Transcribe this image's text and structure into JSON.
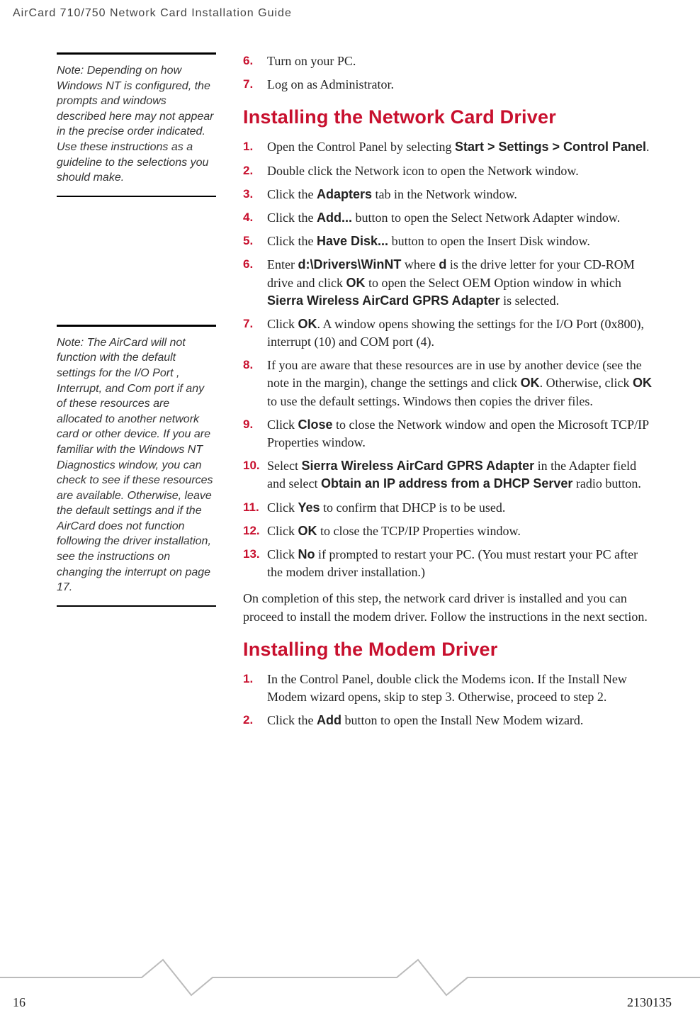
{
  "header": "AirCard 710/750 Network Card Installation Guide",
  "notes": [
    "Note:  Depending on how Windows NT is configured, the prompts and windows described here may not appear in the precise order indicated. Use these instructions as a guideline to the selections you should make.",
    "Note:  The AirCard will not function with the default settings for the I/O Port , Interrupt, and Com port if any of these resources are allocated to another network card or other device. If you are familiar with the Windows NT Diagnostics window, you can check to see if these resources are available. Otherwise, leave the default settings and if the AirCard does not function following the driver installation, see the instructions on changing the interrupt on page 17."
  ],
  "prelim_steps": [
    {
      "n": "6.",
      "text": "Turn on your PC."
    },
    {
      "n": "7.",
      "text": "Log on as Administrator."
    }
  ],
  "h_network": "Installing the Network Card Driver",
  "network_steps": [
    {
      "n": "1.",
      "parts": [
        "Open the Control Panel by selecting ",
        {
          "b": "Start > Settings > Control Panel"
        },
        "."
      ]
    },
    {
      "n": "2.",
      "parts": [
        "Double click the Network icon to open the Network window."
      ]
    },
    {
      "n": "3.",
      "parts": [
        "Click the ",
        {
          "b": "Adapters"
        },
        " tab in the Network window."
      ]
    },
    {
      "n": "4.",
      "parts": [
        "Click the ",
        {
          "b": "Add..."
        },
        " button to open the Select Network Adapter window."
      ]
    },
    {
      "n": "5.",
      "parts": [
        "Click the ",
        {
          "b": "Have Disk..."
        },
        " button to open the Insert Disk window."
      ]
    },
    {
      "n": "6.",
      "parts": [
        "Enter ",
        {
          "b": "d:\\Drivers\\WinNT"
        },
        " where ",
        {
          "b": "d"
        },
        " is the drive letter for your CD-ROM drive and click ",
        {
          "b": "OK"
        },
        " to open the Select OEM Option window in which ",
        {
          "b": "Sierra Wireless AirCard GPRS Adapter"
        },
        " is selected."
      ]
    },
    {
      "n": "7.",
      "parts": [
        "Click ",
        {
          "b": "OK"
        },
        ". A window opens showing the settings for the I/O Port (0x800), interrupt (10) and COM port (4)."
      ]
    },
    {
      "n": "8.",
      "parts": [
        "If you are aware that these resources are in use by another device (see the note in the margin), change the settings and click ",
        {
          "b": "OK"
        },
        ". Otherwise, click ",
        {
          "b": "OK"
        },
        " to use the default settings. Windows then copies the driver files."
      ]
    },
    {
      "n": "9.",
      "parts": [
        "Click ",
        {
          "b": "Close"
        },
        " to close the Network window and open the Microsoft TCP/IP Properties window."
      ]
    },
    {
      "n": "10.",
      "parts": [
        "Select ",
        {
          "b": "Sierra Wireless AirCard GPRS Adapter"
        },
        " in the Adapter field and select ",
        {
          "b": "Obtain an IP address from a DHCP Server"
        },
        " radio button."
      ]
    },
    {
      "n": "11.",
      "parts": [
        "Click ",
        {
          "b": "Yes"
        },
        " to confirm that DHCP is to be used."
      ]
    },
    {
      "n": "12.",
      "parts": [
        "Click ",
        {
          "b": "OK"
        },
        " to close the TCP/IP Properties window."
      ]
    },
    {
      "n": "13.",
      "parts": [
        "Click ",
        {
          "b": "No"
        },
        " if prompted to restart your PC. (You must restart your PC after the modem driver installation.)"
      ]
    }
  ],
  "network_outro": "On completion of this step, the network card driver is installed and you can proceed to install the modem driver. Follow the instructions in the next section.",
  "h_modem": "Installing the Modem Driver",
  "modem_steps": [
    {
      "n": "1.",
      "parts": [
        "In the Control Panel, double click the Modems icon. If the Install New Modem wizard opens, skip to step 3. Otherwise, proceed to step 2."
      ]
    },
    {
      "n": "2.",
      "parts": [
        "Click the ",
        {
          "b": "Add"
        },
        " button to open the Install New Modem wizard."
      ]
    }
  ],
  "footer": {
    "page": "16",
    "docnum": "2130135"
  }
}
